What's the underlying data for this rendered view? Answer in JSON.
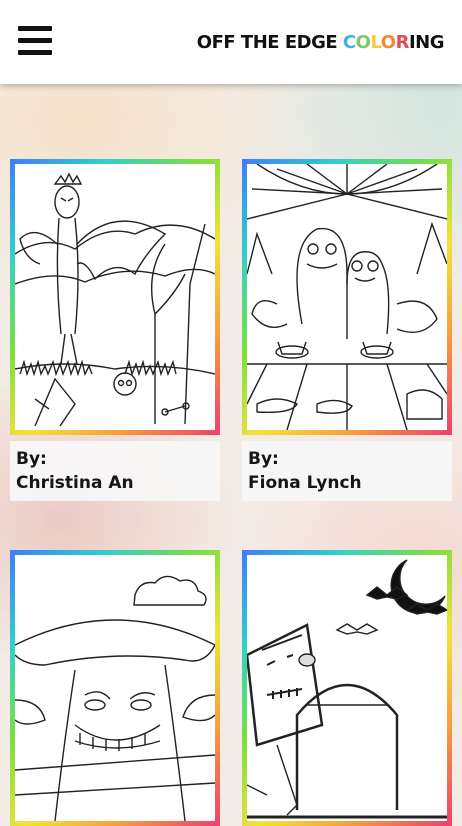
{
  "header": {
    "menu_icon": "hamburger-menu-icon",
    "logo_prefix": "OFF THE EDGE ",
    "logo_letters": [
      "C",
      "O",
      "L",
      "O",
      "R"
    ],
    "logo_suffix": "ING",
    "logo_colors": [
      "#39b6e0",
      "#7cc96b",
      "#f2c74a",
      "#f08a3a",
      "#e54b58"
    ]
  },
  "gallery": {
    "items": [
      {
        "by_label": "By:",
        "artist": "Christina An",
        "art": "winged-alien-king-graveyard"
      },
      {
        "by_label": "By:",
        "artist": "Fiona Lynch",
        "art": "ghost-tea-party-sun"
      },
      {
        "art": "stitched-monster-mountain"
      },
      {
        "art": "frankenstein-rip-tombstone-bats"
      }
    ]
  }
}
